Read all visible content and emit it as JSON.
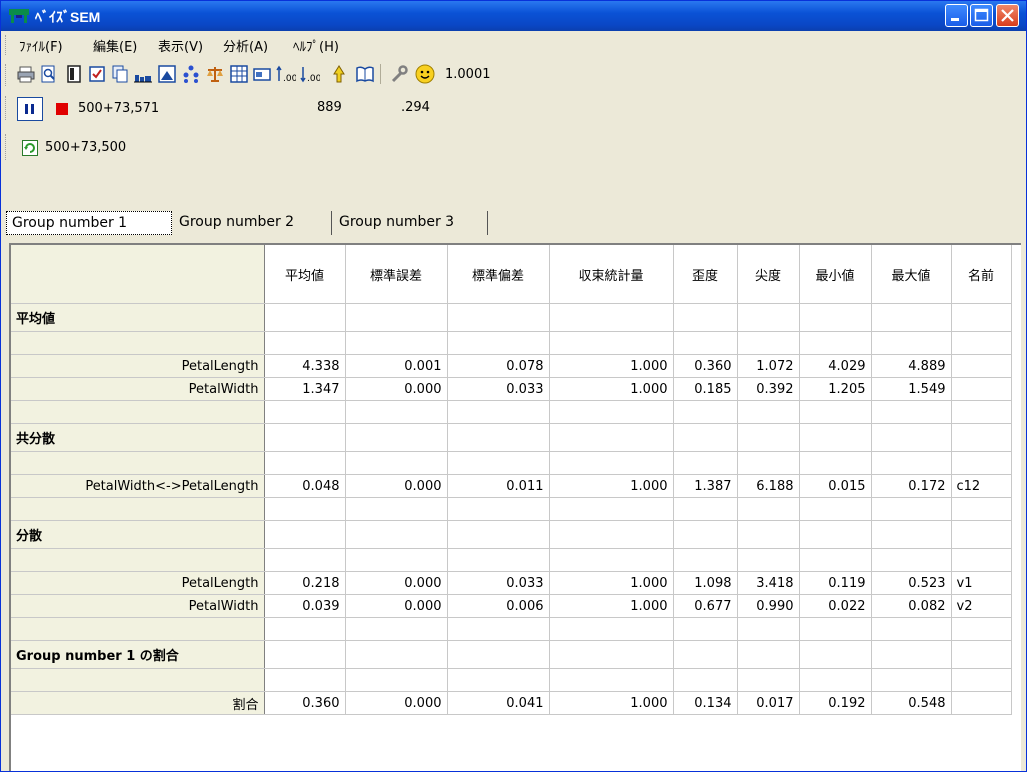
{
  "window": {
    "title": "ﾍﾞｲｽﾞSEM"
  },
  "menu": [
    "ﾌｧｲﾙ(F)",
    "編集(E)",
    "表示(V)",
    "分析(A)",
    "ﾍﾙﾌﾟ(H)"
  ],
  "toolbar": {
    "icons": [
      "print-icon",
      "preview-icon",
      "page-icon",
      "check-icon",
      "copy-icon",
      "bar-chart-icon",
      "image-icon",
      "tree-icon",
      "scale-icon",
      "table-icon",
      "card-icon",
      "increase-decimal-icon",
      "decrease-decimal-icon",
      "lamp-icon",
      "book-icon",
      "wrench-icon",
      "smiley-icon"
    ],
    "version_value": "1.0001"
  },
  "status": {
    "progress_text": "500+73,571",
    "value_a": "889",
    "value_b": ".294",
    "refresh_text": "500+73,500"
  },
  "tabs": [
    "Group number 1",
    "Group number 2",
    "Group number 3"
  ],
  "table": {
    "headers": [
      "平均値",
      "標準誤差",
      "標準偏差",
      "収束統計量",
      "歪度",
      "尖度",
      "最小値",
      "最大値",
      "名前"
    ],
    "sections": [
      {
        "title": "平均値",
        "rows": [
          {
            "label": "PetalLength",
            "values": [
              "4.338",
              "0.001",
              "0.078",
              "1.000",
              "0.360",
              "1.072",
              "4.029",
              "4.889",
              ""
            ]
          },
          {
            "label": "PetalWidth",
            "values": [
              "1.347",
              "0.000",
              "0.033",
              "1.000",
              "0.185",
              "0.392",
              "1.205",
              "1.549",
              ""
            ]
          }
        ]
      },
      {
        "title": "共分散",
        "rows": [
          {
            "label": "PetalWidth<->PetalLength",
            "values": [
              "0.048",
              "0.000",
              "0.011",
              "1.000",
              "1.387",
              "6.188",
              "0.015",
              "0.172",
              "c12"
            ]
          }
        ]
      },
      {
        "title": "分散",
        "rows": [
          {
            "label": "PetalLength",
            "values": [
              "0.218",
              "0.000",
              "0.033",
              "1.000",
              "1.098",
              "3.418",
              "0.119",
              "0.523",
              "v1"
            ]
          },
          {
            "label": "PetalWidth",
            "values": [
              "0.039",
              "0.000",
              "0.006",
              "1.000",
              "0.677",
              "0.990",
              "0.022",
              "0.082",
              "v2"
            ]
          }
        ]
      },
      {
        "title": "Group number 1 の割合",
        "rows": [
          {
            "label": "割合",
            "values": [
              "0.360",
              "0.000",
              "0.041",
              "1.000",
              "0.134",
              "0.017",
              "0.192",
              "0.548",
              ""
            ]
          }
        ]
      }
    ]
  }
}
